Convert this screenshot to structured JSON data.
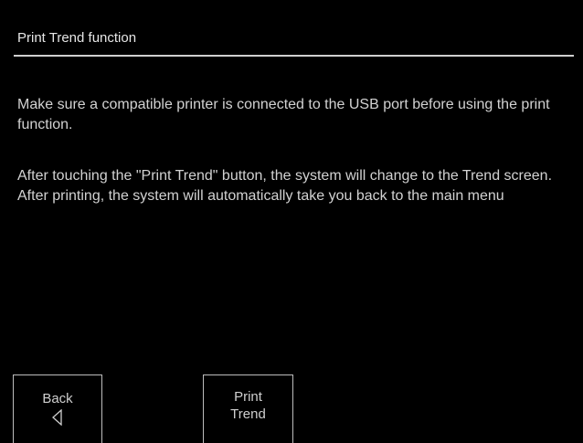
{
  "header": {
    "title": "Print Trend function"
  },
  "content": {
    "paragraphs": [
      "Make sure a compatible printer is connected to the USB port before using the print function.",
      "After touching the \"Print Trend\" button, the system will change to the Trend screen.\nAfter printing, the system will automatically take you back to the main menu"
    ]
  },
  "buttons": {
    "back": {
      "label": "Back",
      "icon": "left-triangle-outline-icon"
    },
    "print_trend": {
      "line1": "Print",
      "line2": "Trend"
    }
  },
  "colors": {
    "background": "#000000",
    "text": "#d2d2d2",
    "rule": "#cfcfcf"
  }
}
